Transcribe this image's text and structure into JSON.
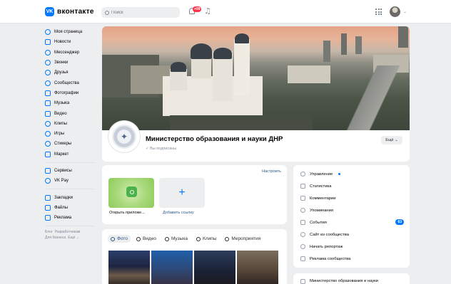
{
  "header": {
    "logo_mark": "VK",
    "logo_text": "вконтакте",
    "search_placeholder": "Поиск",
    "notifications_count": "+99",
    "music_icon": "music-note-icon"
  },
  "sidebar": {
    "items": [
      {
        "label": "Моя страница",
        "icon": "user-circle-icon"
      },
      {
        "label": "Новости",
        "icon": "news-icon"
      },
      {
        "label": "Мессенджер",
        "icon": "chat-icon"
      },
      {
        "label": "Звонки",
        "icon": "phone-icon"
      },
      {
        "label": "Друзья",
        "icon": "friends-icon"
      },
      {
        "label": "Сообщества",
        "icon": "community-icon"
      },
      {
        "label": "Фотографии",
        "icon": "photo-icon"
      },
      {
        "label": "Музыка",
        "icon": "music-icon"
      },
      {
        "label": "Видео",
        "icon": "video-icon"
      },
      {
        "label": "Клипы",
        "icon": "clips-icon"
      },
      {
        "label": "Игры",
        "icon": "gamepad-icon"
      },
      {
        "label": "Стикеры",
        "icon": "sticker-icon"
      },
      {
        "label": "Маркет",
        "icon": "market-icon"
      }
    ],
    "items2": [
      {
        "label": "Сервисы",
        "icon": "services-icon"
      },
      {
        "label": "VK Pay",
        "icon": "vkpay-icon"
      }
    ],
    "items3": [
      {
        "label": "Закладки",
        "icon": "bookmark-icon"
      },
      {
        "label": "Файлы",
        "icon": "file-icon"
      },
      {
        "label": "Реклама",
        "icon": "ads-icon"
      }
    ],
    "footer": {
      "blog": "Блог",
      "developers": "Разработчикам",
      "business": "Для бизнеса",
      "more": "Ещё ⌄"
    }
  },
  "group": {
    "name": "Министерство образования и науки ДНР",
    "subscribed": "✓ Вы подписаны",
    "more_button": "Ещё ⌄"
  },
  "apps": {
    "config_link": "Настроить",
    "open_app": "Открыть приложе...",
    "add_link": "Добавить ссылку",
    "add_symbol": "+"
  },
  "media": {
    "tabs": [
      "Фото",
      "Видео",
      "Музыка",
      "Клипы",
      "Мероприятия"
    ]
  },
  "management": {
    "items": [
      {
        "label": "Управление",
        "icon": "settings-icon"
      },
      {
        "label": "Статистика",
        "icon": "stats-icon"
      },
      {
        "label": "Комментарии",
        "icon": "comment-icon"
      },
      {
        "label": "Упоминания",
        "icon": "mention-icon"
      },
      {
        "label": "События",
        "icon": "events-icon",
        "badge": "63"
      },
      {
        "label": "Сайт из сообщества",
        "icon": "globe-icon"
      },
      {
        "label": "Начать репортаж",
        "icon": "broadcast-icon"
      },
      {
        "label": "Реклама сообщества",
        "icon": "megaphone-icon"
      }
    ],
    "bottom_item": "Министерство образования и науки"
  },
  "colors": {
    "accent": "#0077ff",
    "background": "#edeef0",
    "link": "#2a5885",
    "badge_red": "#ff3347"
  }
}
